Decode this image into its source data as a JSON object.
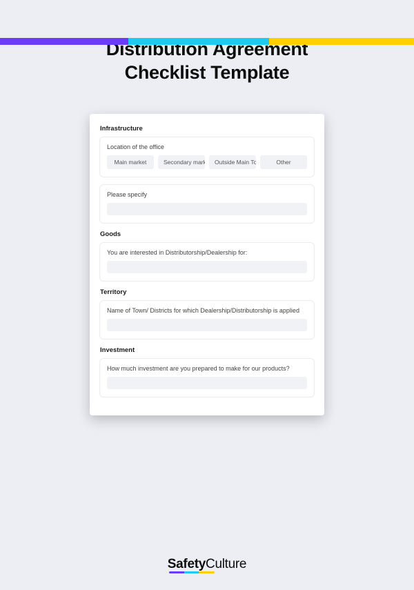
{
  "title_line1": "Distribution Agreement",
  "title_line2": "Checklist Template",
  "sections": {
    "infrastructure": {
      "heading": "Infrastructure",
      "location_label": "Location of the office",
      "options": [
        "Main market",
        "Secondary market",
        "Outside Main Tow",
        "Other"
      ],
      "specify_label": "Please specify"
    },
    "goods": {
      "heading": "Goods",
      "label": "You are interested in Distributorship/Dealership for:"
    },
    "territory": {
      "heading": "Territory",
      "label": "Name of Town/ Districts for which Dealership/Distributorship is applied"
    },
    "investment": {
      "heading": "Investment",
      "label": "How much investment are you prepared to make for our products?"
    }
  },
  "brand": {
    "first": "Safety",
    "second": "Culture"
  }
}
